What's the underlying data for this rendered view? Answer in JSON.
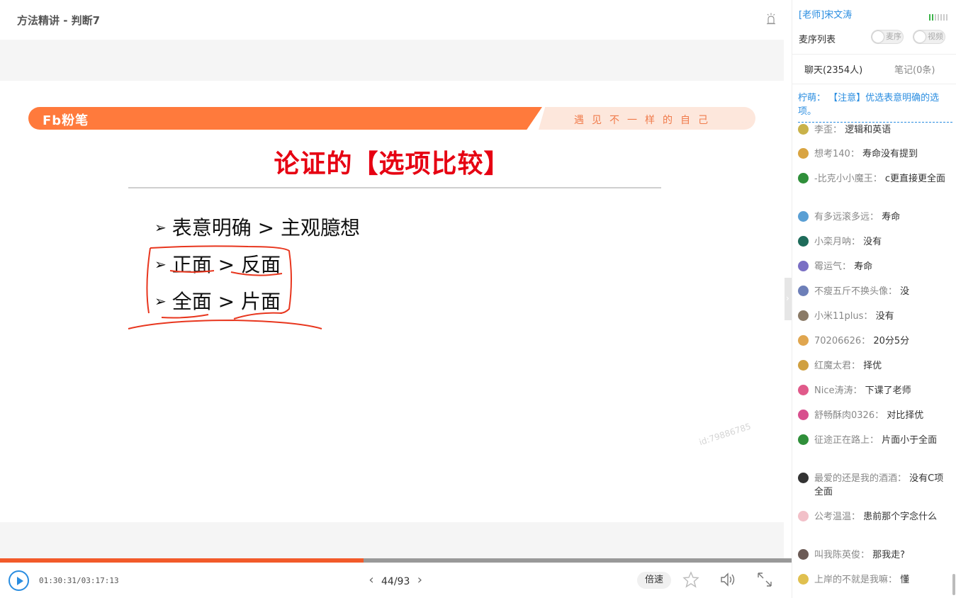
{
  "header": {
    "title": "方法精讲 - 判断7",
    "bell_icon": "bell-icon"
  },
  "slide": {
    "logo": "Fb粉笔",
    "slogan": "遇见不一样的自己",
    "title": "论证的【选项比较】",
    "bullets": [
      {
        "arrow": "➢",
        "text": "表意明确 > 主观臆想"
      },
      {
        "arrow": "➢",
        "text": "正面 > 反面"
      },
      {
        "arrow": "➢",
        "text": "全面 > 片面"
      }
    ],
    "watermark": "id:79886785",
    "ink_color": "#e8361e"
  },
  "player": {
    "progress_fraction": 0.4595,
    "time": "01:30:31/03:17:13",
    "page_current": "44",
    "page_total": "93",
    "page": "44/93",
    "speed_label": "倍速",
    "accent": "#2a8de0",
    "progress_color": "#f25a2a"
  },
  "sidebar": {
    "teacher": "[老师]宋文涛",
    "queue_label": "麦序列表",
    "toggle_mic": "麦序",
    "toggle_video": "视频",
    "tab_chat": "聊天(2354人)",
    "tab_notes": "笔记(0条)",
    "pinned": "柠萌： 【注意】优选表意明确的选项。",
    "messages": [
      {
        "nick": "李歪：",
        "text": "逻辑和英语",
        "avatar": "#c9b24a"
      },
      {
        "nick": "想考140：",
        "text": "寿命没有提到",
        "avatar": "#d9a441"
      },
      {
        "nick": "-比克小小魔王：",
        "text": "c更直接更全面",
        "avatar": "#2f8f3a"
      },
      {
        "nick": "有多远滚多远：",
        "text": "寿命",
        "avatar": "#5a9fd4"
      },
      {
        "nick": "小栾月呐：",
        "text": "没有",
        "avatar": "#1e6b5a"
      },
      {
        "nick": "霉运气：",
        "text": "寿命",
        "avatar": "#7a6fc4"
      },
      {
        "nick": "不瘦五斤不换头像：",
        "text": "没",
        "avatar": "#6d7fb8"
      },
      {
        "nick": "小米11plus：",
        "text": "没有",
        "avatar": "#8a7a66"
      },
      {
        "nick": "70206626：",
        "text": "20分5分",
        "avatar": "#e0a64f"
      },
      {
        "nick": "红魔太君：",
        "text": "择优",
        "avatar": "#d0a040"
      },
      {
        "nick": "Nice涛涛：",
        "text": "下课了老师",
        "avatar": "#e05a8a"
      },
      {
        "nick": "舒畅酥肉0326：",
        "text": "对比择优",
        "avatar": "#d84f8e"
      },
      {
        "nick": "征途正在路上：",
        "text": "片面小于全面",
        "avatar": "#2f8f3a"
      },
      {
        "nick": "最爱的还是我的酒酒：",
        "text": "没有C项全面",
        "avatar": "#333333"
      },
      {
        "nick": "公考温温：",
        "text": "患前那个字念什么",
        "avatar": "#f2c0c8"
      },
      {
        "nick": "叫我陈英俊：",
        "text": "那我走?",
        "avatar": "#6b5a55"
      },
      {
        "nick": "上岸的不就是我嘛：",
        "text": "懂",
        "avatar": "#e0c04f"
      }
    ]
  }
}
